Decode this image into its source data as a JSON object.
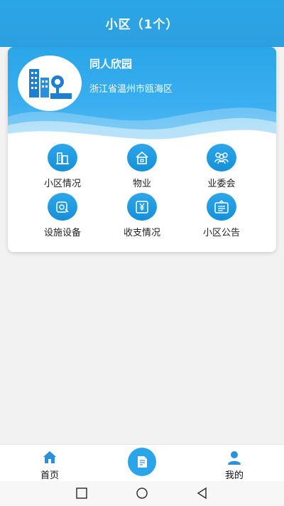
{
  "header": {
    "title": "小区（1个）"
  },
  "community": {
    "name": "同人欣园",
    "address": "浙江省温州市瓯海区",
    "logo_text": "同人欣园"
  },
  "grid": [
    {
      "label": "小区情况",
      "icon": "building-icon"
    },
    {
      "label": "物业",
      "icon": "house-icon"
    },
    {
      "label": "业委会",
      "icon": "group-icon"
    },
    {
      "label": "设施设备",
      "icon": "facility-icon"
    },
    {
      "label": "收支情况",
      "icon": "yuan-icon"
    },
    {
      "label": "小区公告",
      "icon": "notice-icon"
    }
  ],
  "tabbar": {
    "home_label": "首页",
    "mine_label": "我的"
  },
  "colors": {
    "accent": "#2aa6e6"
  }
}
